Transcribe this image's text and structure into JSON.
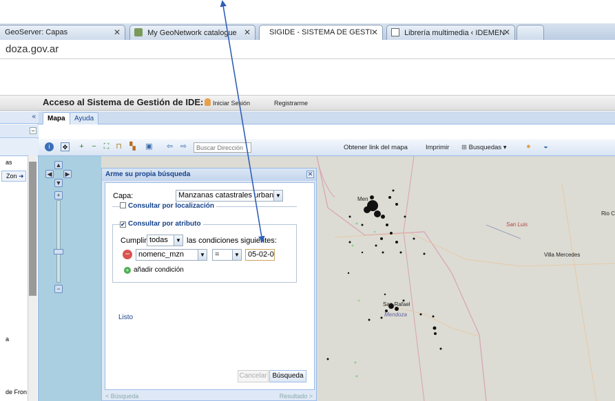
{
  "browser": {
    "tabs": [
      {
        "title": "GeoServer: Capas",
        "close": "✕"
      },
      {
        "title": "My GeoNetwork catalogue",
        "close": "✕"
      },
      {
        "title": "SIGIDE - SISTEMA DE GESTI",
        "close": "✕"
      },
      {
        "title": "Librería multimedia ‹ IDEMEN",
        "close": "✕"
      }
    ],
    "url": "doza.gov.ar"
  },
  "app": {
    "title": "Acceso al Sistema de Gestión de IDE:",
    "login": "Iniciar Sesión",
    "register": "Registrarme",
    "tabs": [
      "Mapa",
      "Ayuda"
    ],
    "collapse": "«"
  },
  "left_panel": {
    "items": [
      "as",
      "Zon"
    ],
    "bottom_text": [
      "a",
      "de Fron"
    ]
  },
  "toolbar": {
    "search_placeholder": "Buscar Dirección",
    "get_link": "Obtener link del mapa",
    "print": "Imprimir",
    "searches": "Busquedas"
  },
  "map": {
    "labels": [
      "Men",
      "San Luis",
      "Villa Mercedes",
      "Rio C",
      "San Rafael",
      "Mendoza"
    ]
  },
  "dialog": {
    "title": "Arme su propia búsqueda",
    "close": "✕",
    "layer_label": "Capa:",
    "layer_value": "Manzanas catastrales urban",
    "by_location": "Consultar por localización",
    "by_attribute": "Consultar por atributo",
    "match_label": "Cumplir",
    "match_value": "todas",
    "match_suffix": "las condiciones siguientes:",
    "field_value": "nomenc_mzn",
    "operator_value": "=",
    "condition_value": "05-02-0",
    "add_condition": "añadir condición",
    "status": "Listo",
    "cancel": "Cancelar",
    "search": "Búsqueda",
    "footer_left": "< Búsqueda",
    "footer_right": "Resultado >"
  },
  "colors": {
    "accent": "#15428b",
    "border": "#99bbe8",
    "arrow": "#2f5fb5"
  }
}
